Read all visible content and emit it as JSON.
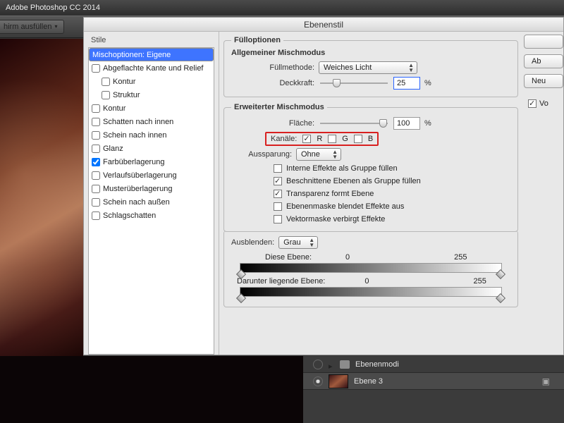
{
  "app": {
    "title": "Adobe Photoshop CC 2014"
  },
  "toolbar": {
    "fill_button": "hirm ausfüllen"
  },
  "dialog": {
    "title": "Ebenenstil",
    "sidebar_header": "Stile",
    "sidebar": [
      {
        "name": "Mischoptionen: Eigene",
        "selected": true,
        "checkbox": false
      },
      {
        "name": "Abgeflachte Kante und Relief",
        "checked": false,
        "checkbox": true
      },
      {
        "name": "Kontur",
        "checked": false,
        "checkbox": true,
        "indent": true
      },
      {
        "name": "Struktur",
        "checked": false,
        "checkbox": true,
        "indent": true
      },
      {
        "name": "Kontur",
        "checked": false,
        "checkbox": true
      },
      {
        "name": "Schatten nach innen",
        "checked": false,
        "checkbox": true
      },
      {
        "name": "Schein nach innen",
        "checked": false,
        "checkbox": true
      },
      {
        "name": "Glanz",
        "checked": false,
        "checkbox": true
      },
      {
        "name": "Farbüberlagerung",
        "checked": true,
        "checkbox": true
      },
      {
        "name": "Verlaufsüberlagerung",
        "checked": false,
        "checkbox": true
      },
      {
        "name": "Musterüberlagerung",
        "checked": false,
        "checkbox": true
      },
      {
        "name": "Schein nach außen",
        "checked": false,
        "checkbox": true
      },
      {
        "name": "Schlagschatten",
        "checked": false,
        "checkbox": true
      }
    ],
    "fill_options": {
      "title": "Fülloptionen",
      "general_title": "Allgemeiner Mischmodus",
      "blend_label": "Füllmethode:",
      "blend_value": "Weiches Licht",
      "opacity_label": "Deckkraft:",
      "opacity_value": "25",
      "pct": "%"
    },
    "advanced": {
      "title": "Erweiterter Mischmodus",
      "fill_label": "Fläche:",
      "fill_value": "100",
      "channels_label": "Kanäle:",
      "ch_r": "R",
      "ch_g": "G",
      "ch_b": "B",
      "ch_r_on": true,
      "ch_g_on": false,
      "ch_b_on": false,
      "knockout_label": "Aussparung:",
      "knockout_value": "Ohne",
      "cb1": "Interne Effekte als Gruppe füllen",
      "cb2": "Beschnittene Ebenen als Gruppe füllen",
      "cb3": "Transparenz formt Ebene",
      "cb4": "Ebenenmaske blendet Effekte aus",
      "cb5": "Vektormaske verbirgt Effekte",
      "cb1_on": false,
      "cb2_on": true,
      "cb3_on": true,
      "cb4_on": false,
      "cb5_on": false
    },
    "blendif": {
      "title": "Ausblenden:",
      "value": "Grau",
      "this_label": "Diese Ebene:",
      "under_label": "Darunter liegende Ebene:",
      "low": "0",
      "high": "255"
    },
    "buttons": {
      "ok": "",
      "cancel": "Ab",
      "new_style": "Neu",
      "preview": "Vo"
    }
  },
  "layers": {
    "group": "Ebenenmodi",
    "layer": "Ebene 3"
  }
}
